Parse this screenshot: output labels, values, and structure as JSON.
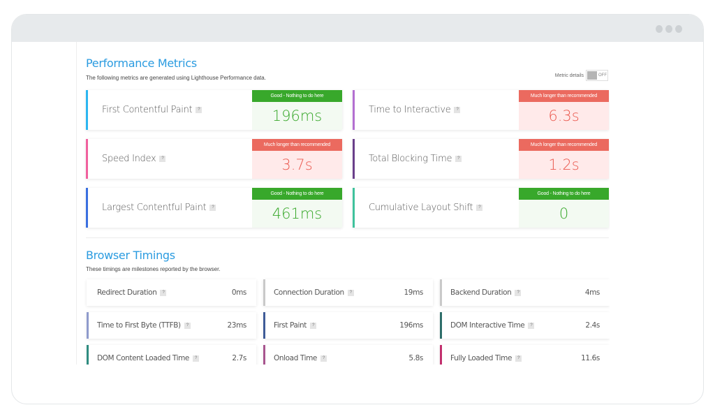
{
  "window": {
    "controls": [
      "dot",
      "dot",
      "dot"
    ]
  },
  "performance": {
    "title": "Performance Metrics",
    "subtitle": "The following metrics are generated using Lighthouse Performance data.",
    "toggle": {
      "label": "Metric details",
      "state": "OFF"
    },
    "help_glyph": "?",
    "metrics": [
      {
        "name": "First Contentful Paint",
        "grade": "good",
        "badge": "Good - Nothing to do here",
        "value": "196ms",
        "color": "#2bb6f0"
      },
      {
        "name": "Time to Interactive",
        "grade": "bad",
        "badge": "Much longer than recommended",
        "value": "6.3s",
        "color": "#b36fd1"
      },
      {
        "name": "Speed Index",
        "grade": "bad",
        "badge": "Much longer than recommended",
        "value": "3.7s",
        "color": "#f0609e"
      },
      {
        "name": "Total Blocking Time",
        "grade": "bad",
        "badge": "Much longer than recommended",
        "value": "1.2s",
        "color": "#6a3f8a"
      },
      {
        "name": "Largest Contentful Paint",
        "grade": "good",
        "badge": "Good - Nothing to do here",
        "value": "461ms",
        "color": "#3a6fe0"
      },
      {
        "name": "Cumulative Layout Shift",
        "grade": "good",
        "badge": "Good - Nothing to do here",
        "value": "0",
        "color": "#3fc29c"
      }
    ],
    "colors": {
      "good": "#38a82b",
      "bad": "#eb6a5f",
      "title": "#2a9be0"
    }
  },
  "browser_timings": {
    "title": "Browser Timings",
    "subtitle": "These timings are milestones reported by the browser.",
    "items": [
      {
        "name": "Redirect Duration",
        "value": "0ms",
        "color": "#ffffff"
      },
      {
        "name": "Connection Duration",
        "value": "19ms",
        "color": "#c9c9c9"
      },
      {
        "name": "Backend Duration",
        "value": "4ms",
        "color": "#c9c9c9"
      },
      {
        "name": "Time to First Byte (TTFB)",
        "value": "23ms",
        "color": "#8f9bcc"
      },
      {
        "name": "First Paint",
        "value": "196ms",
        "color": "#3f5c98"
      },
      {
        "name": "DOM Interactive Time",
        "value": "2.4s",
        "color": "#2e6e6a"
      },
      {
        "name": "DOM Content Loaded Time",
        "value": "2.7s",
        "color": "#2f8c80"
      },
      {
        "name": "Onload Time",
        "value": "5.8s",
        "color": "#a8558f"
      },
      {
        "name": "Fully Loaded Time",
        "value": "11.6s",
        "color": "#c2306e"
      }
    ]
  }
}
